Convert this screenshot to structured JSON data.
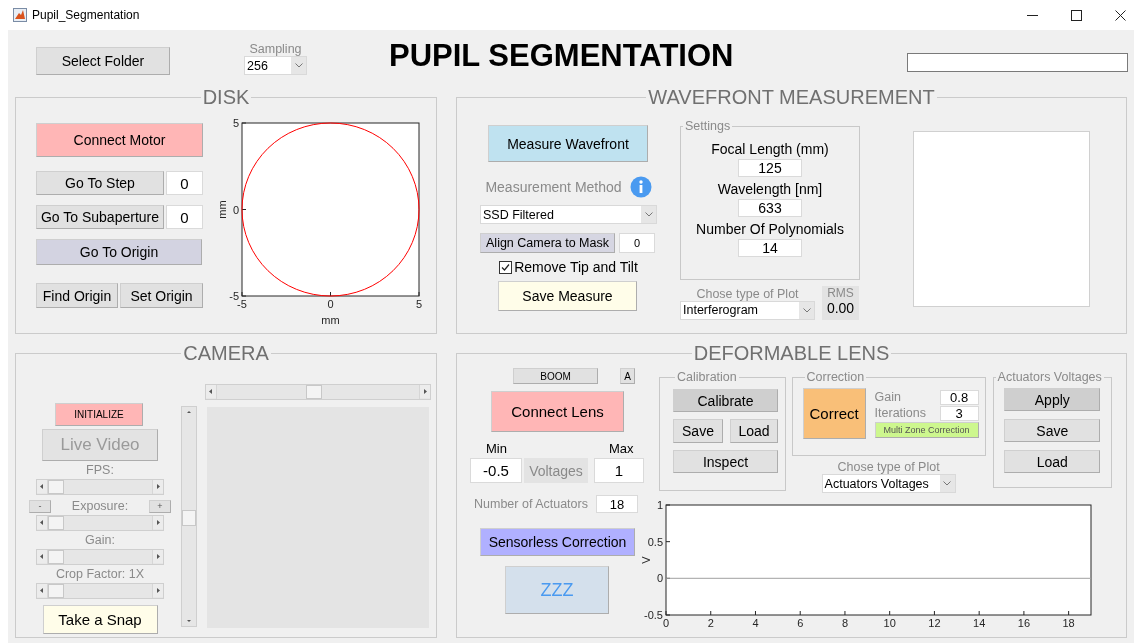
{
  "window": {
    "title": "Pupil_Segmentation"
  },
  "header": {
    "select_folder": "Select Folder",
    "sampling": {
      "label": "Sampling",
      "value": "256"
    },
    "title": "PUPIL SEGMENTATION"
  },
  "disk": {
    "title": "DISK",
    "connect": "Connect Motor",
    "go_to_step": {
      "label": "Go To Step",
      "value": "0"
    },
    "go_to_subaperture": {
      "label": "Go To Subaperture",
      "value": "0"
    },
    "go_to_origin": "Go To Origin",
    "find_origin": "Find Origin",
    "set_origin": "Set Origin",
    "plot": {
      "xlabel": "mm",
      "ylabel": "mm",
      "xticks": [
        "-5",
        "0",
        "5"
      ],
      "yticks": [
        "5",
        "0",
        "-5"
      ]
    }
  },
  "wavefront": {
    "title": "WAVEFRONT MEASUREMENT",
    "measure": "Measure Wavefront",
    "method_label": "Measurement Method",
    "method": "SSD Filtered",
    "align": {
      "label": "Align Camera to Mask",
      "value": "0"
    },
    "remove_tip_tilt": {
      "label": "Remove Tip and Tilt",
      "checked": true
    },
    "save": "Save Measure",
    "settings": {
      "title": "Settings",
      "fields": [
        {
          "label": "Focal Length (mm)",
          "value": "125"
        },
        {
          "label": "Wavelength [nm]",
          "value": "633"
        },
        {
          "label": "Number Of Polynomials",
          "value": "14"
        }
      ]
    },
    "plot_type": {
      "label": "Chose type of Plot",
      "value": "Interferogram"
    },
    "rms": {
      "label": "RMS",
      "value": "0.00"
    }
  },
  "camera": {
    "title": "CAMERA",
    "initialize": "INITIALIZE",
    "live_video": {
      "label": "Live Video",
      "disabled": true
    },
    "pan_slider": {
      "level": 0.47
    },
    "tilt_slider": {
      "level": 0.5
    },
    "sliders": [
      {
        "kind": "plain",
        "label": "FPS:",
        "level": 0
      },
      {
        "kind": "stepped",
        "label": "Exposure:",
        "minus": "-",
        "plus": "+",
        "level": 0
      },
      {
        "kind": "plain",
        "label": "Gain:",
        "level": 0
      },
      {
        "kind": "plain",
        "label": "Crop Factor: 1X",
        "level": 0
      }
    ],
    "snap": "Take a Snap"
  },
  "lens": {
    "title": "DEFORMABLE LENS",
    "boom": "BOOM",
    "a": "A",
    "connect": "Connect Lens",
    "min": {
      "label": "Min",
      "value": "-0.5"
    },
    "max": {
      "label": "Max",
      "value": "1"
    },
    "voltages": "Voltages",
    "actuators": {
      "label": "Number of Actuators",
      "value": "18"
    },
    "sensorless": "Sensorless Correction",
    "zzz": "ZZZ",
    "calibration": {
      "title": "Calibration",
      "calibrate": "Calibrate",
      "save": "Save",
      "load": "Load",
      "inspect": "Inspect"
    },
    "correction": {
      "title": "Correction",
      "correct": "Correct",
      "gain": {
        "label": "Gain",
        "value": "0.8"
      },
      "iterations": {
        "label": "Iterations",
        "value": "3"
      },
      "multi_zone": "Multi Zone Correction"
    },
    "plot_type": {
      "label": "Chose type of Plot",
      "value": "Actuators Voltages"
    },
    "voltages_group": {
      "title": "Actuators Voltages",
      "apply": "Apply",
      "save": "Save",
      "load": "Load"
    },
    "chart_data": {
      "type": "line",
      "ylabel": "V",
      "xlim": [
        0,
        19
      ],
      "ylim": [
        -0.5,
        1
      ],
      "xticks": [
        0,
        2,
        4,
        6,
        8,
        10,
        12,
        14,
        16,
        18
      ],
      "yticks": [
        -0.5,
        0,
        0.5,
        1
      ],
      "x": [
        0,
        19
      ],
      "series": [
        {
          "color": "#a0a0a0",
          "values": [
            0,
            0
          ]
        }
      ]
    }
  }
}
